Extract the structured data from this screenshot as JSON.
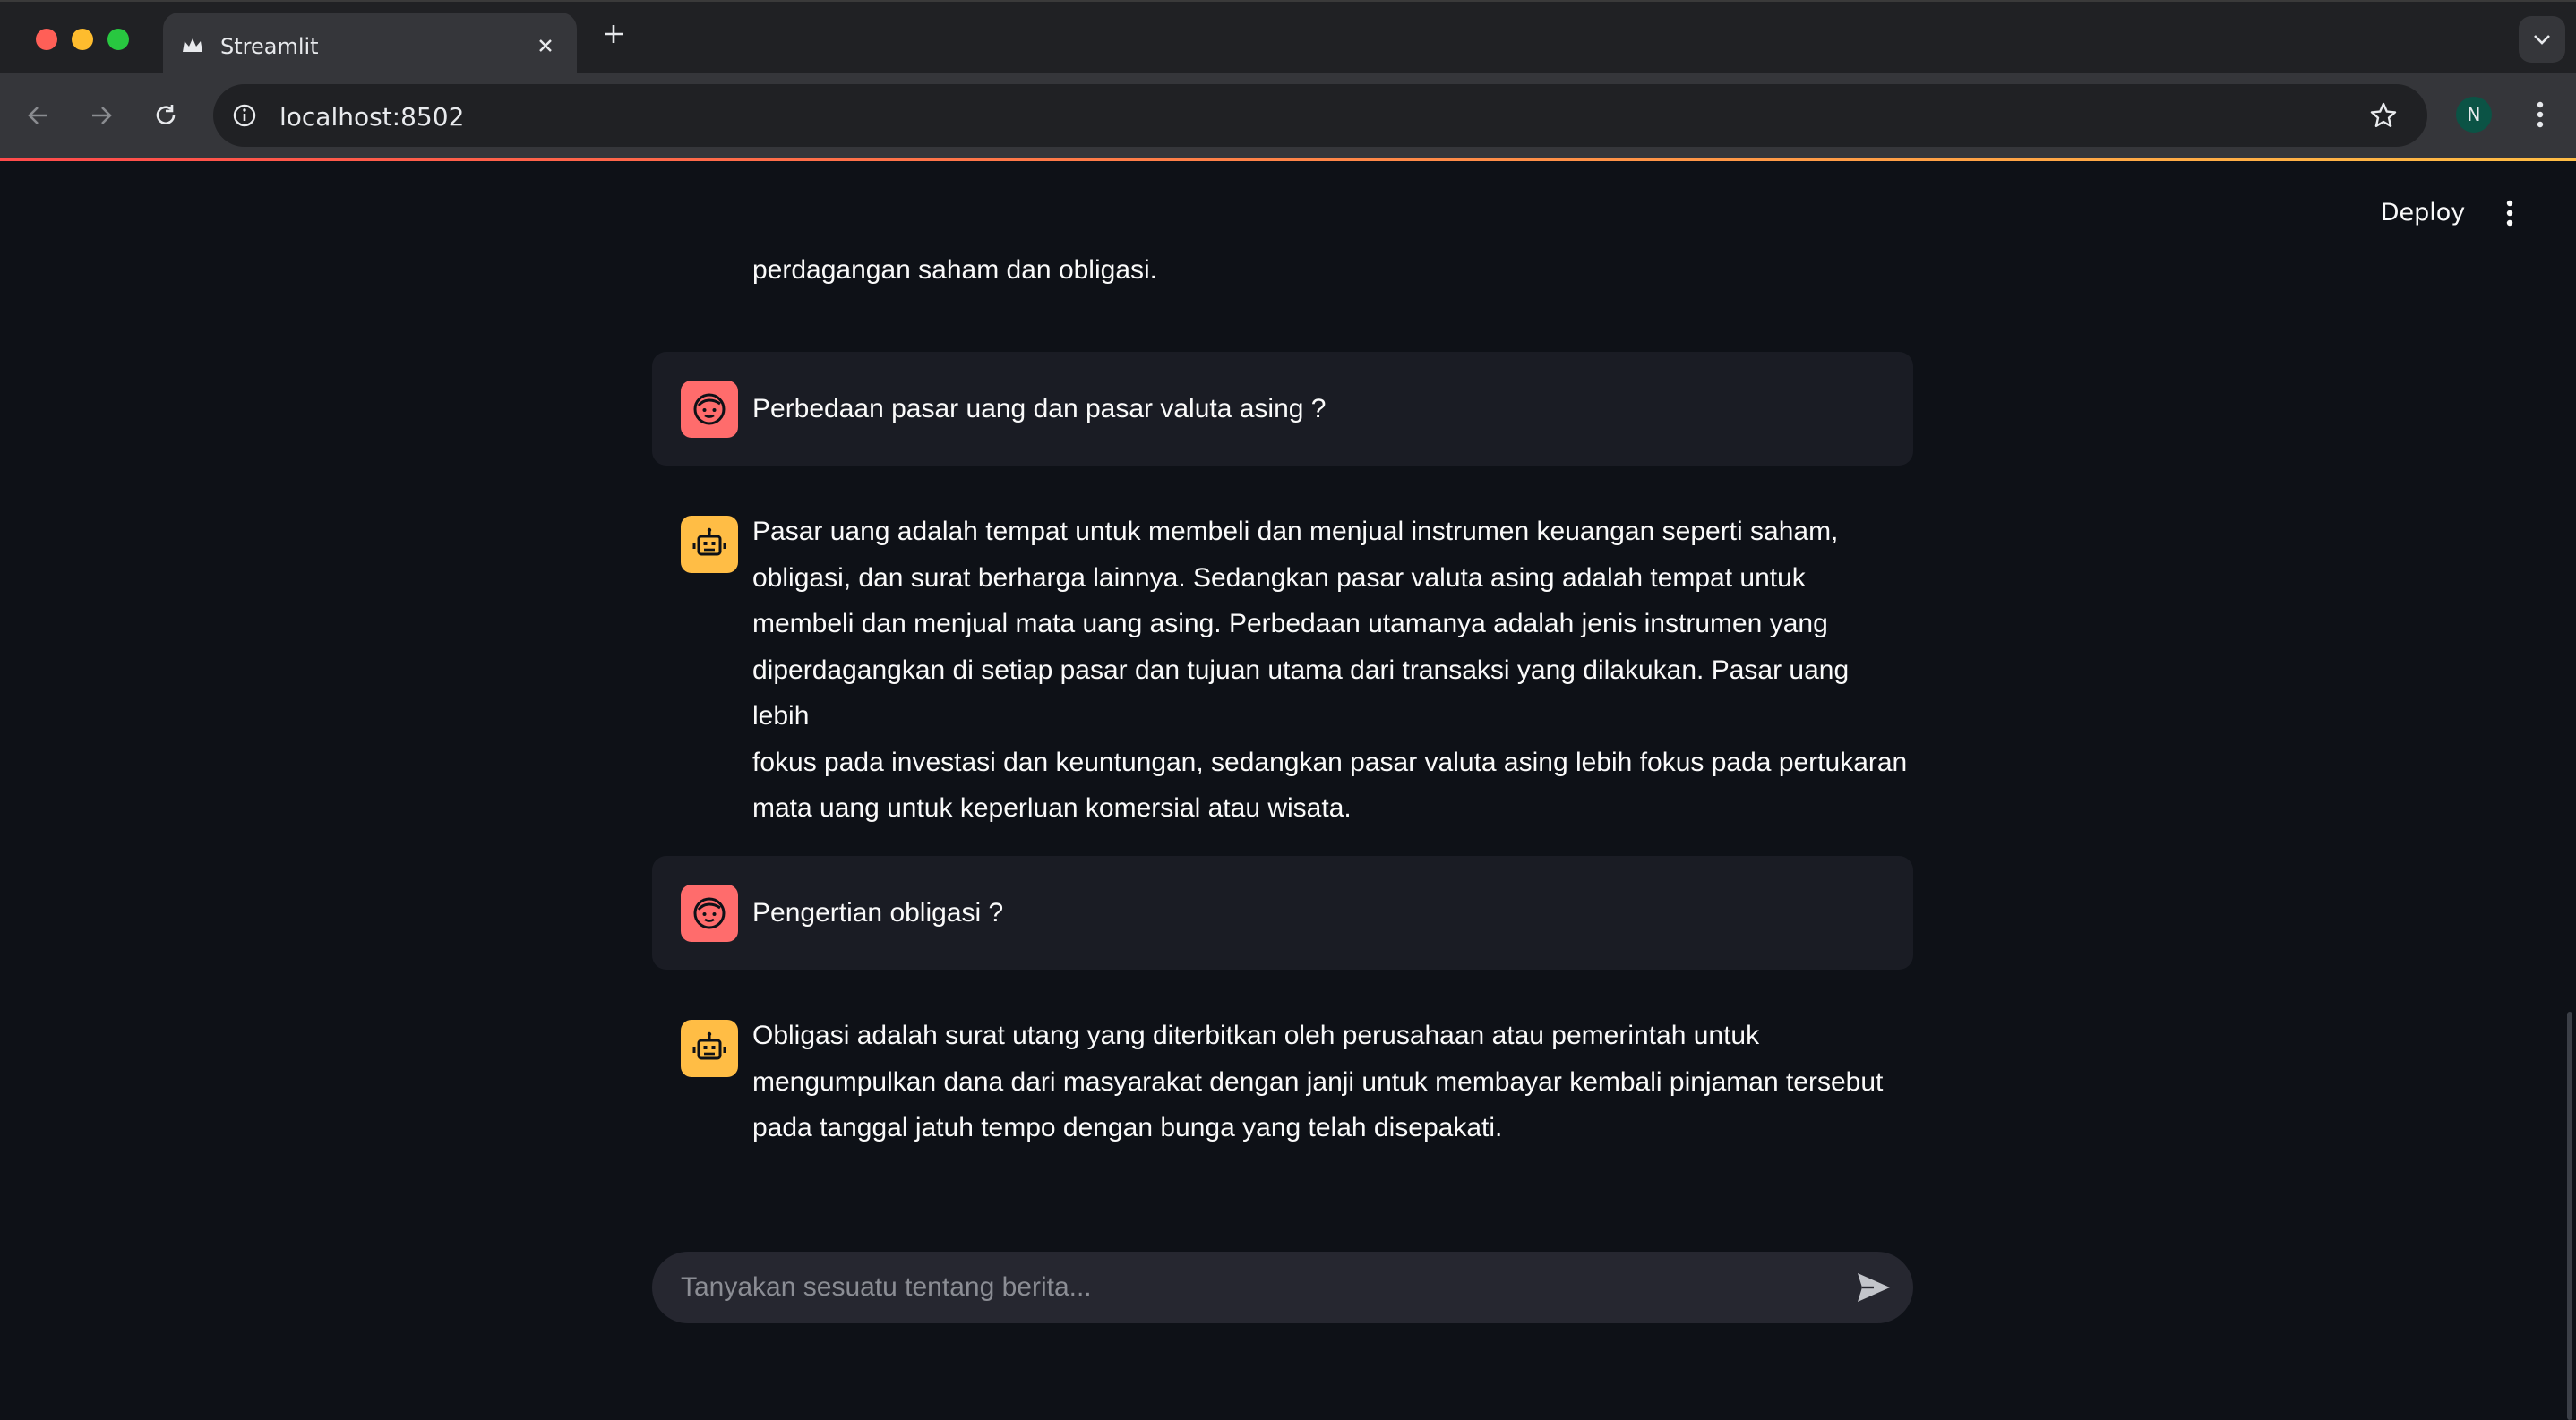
{
  "browser": {
    "tab_title": "Streamlit",
    "url": "localhost:8502",
    "profile_initial": "N",
    "icons": {
      "back": "arrow-left-icon",
      "forward": "arrow-right-icon",
      "reload": "reload-icon",
      "site_info": "info-icon",
      "bookmark": "star-icon",
      "menu": "kebab-menu-icon",
      "tab_list": "chevron-down-icon",
      "new_tab": "plus-icon",
      "close_tab": "close-icon"
    }
  },
  "app": {
    "deploy_label": "Deploy",
    "top_fragment": "perdagangan saham dan obligasi.",
    "messages": [
      {
        "role": "user",
        "text": "Perbedaan pasar uang dan pasar valuta asing ?"
      },
      {
        "role": "assistant",
        "lines": [
          "Pasar uang adalah tempat untuk membeli dan menjual instrumen keuangan seperti saham,",
          "obligasi, dan surat berharga lainnya. Sedangkan pasar valuta asing adalah tempat untuk",
          "membeli dan menjual mata uang asing. Perbedaan utamanya adalah jenis instrumen yang",
          "diperdagangkan di setiap pasar dan tujuan utama dari transaksi yang dilakukan. Pasar uang lebih",
          "fokus pada investasi dan keuntungan, sedangkan pasar valuta asing lebih fokus pada pertukaran",
          "mata uang untuk keperluan komersial atau wisata."
        ]
      },
      {
        "role": "user",
        "text": "Pengertian obligasi ?"
      },
      {
        "role": "assistant",
        "lines": [
          "Obligasi adalah surat utang yang diterbitkan oleh perusahaan atau pemerintah untuk",
          "mengumpulkan dana dari masyarakat dengan janji untuk membayar kembali pinjaman tersebut",
          "pada tanggal jatuh tempo dengan bunga yang telah disepakati."
        ]
      }
    ],
    "chat_input": {
      "placeholder": "Tanyakan sesuatu tentang berita...",
      "value": ""
    },
    "colors": {
      "background": "#0e1117",
      "user_bubble": "#1a1c24",
      "user_avatar": "#ff6c6c",
      "bot_avatar": "#ffbd45",
      "input_bg": "#262730"
    }
  }
}
